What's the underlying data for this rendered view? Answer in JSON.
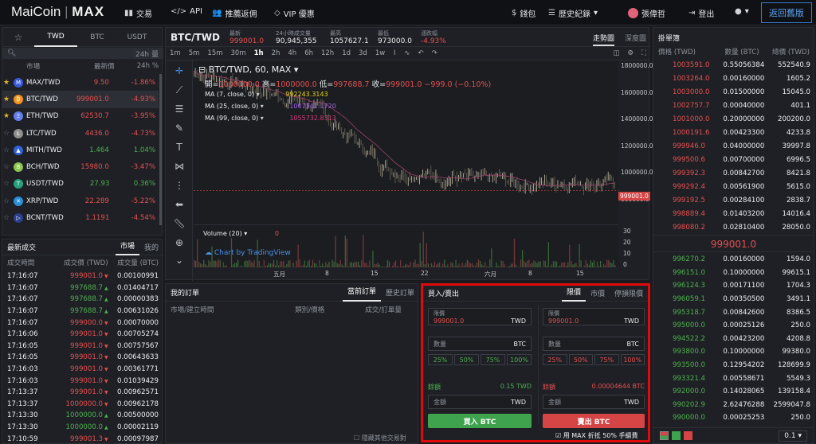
{
  "nav": {
    "logo_a": "MaiCoin",
    "logo_b": "MAX",
    "trade": "交易",
    "api": "API",
    "rebate": "推薦返佣",
    "vip": "VIP 優惠",
    "wallet": "錢包",
    "history": "歷史紀錄",
    "user": "張偉哲",
    "logout": "登出",
    "back": "返回舊版"
  },
  "market": {
    "tabs": [
      "TWD",
      "BTC",
      "USDT"
    ],
    "search_placeholder": "",
    "sort": "24h 量",
    "h_market": "市場",
    "h_price": "最新價",
    "h_change": "24h %",
    "rows": [
      {
        "fav": true,
        "icon": "M",
        "color": "#3a5bd9",
        "name": "MAX/TWD",
        "price": "9.50",
        "chg": "-1.86%",
        "up": false
      },
      {
        "fav": true,
        "icon": "₿",
        "color": "#f7931a",
        "name": "BTC/TWD",
        "price": "999001.0",
        "chg": "-4.93%",
        "up": false
      },
      {
        "fav": true,
        "icon": "Ξ",
        "color": "#627eea",
        "name": "ETH/TWD",
        "price": "62530.7",
        "chg": "-3.95%",
        "up": false
      },
      {
        "fav": false,
        "icon": "Ł",
        "color": "#8e8e8e",
        "name": "LTC/TWD",
        "price": "4436.0",
        "chg": "-4.73%",
        "up": false
      },
      {
        "fav": false,
        "icon": "▲",
        "color": "#2f64d8",
        "name": "MITH/TWD",
        "price": "1.464",
        "chg": "1.04%",
        "up": true
      },
      {
        "fav": false,
        "icon": "B",
        "color": "#8dc351",
        "name": "BCH/TWD",
        "price": "15980.0",
        "chg": "-3.47%",
        "up": false
      },
      {
        "fav": false,
        "icon": "T",
        "color": "#26a17b",
        "name": "USDT/TWD",
        "price": "27.93",
        "chg": "0.36%",
        "up": true
      },
      {
        "fav": false,
        "icon": "✕",
        "color": "#2a8fd6",
        "name": "XRP/TWD",
        "price": "22.289",
        "chg": "-5.22%",
        "up": false
      },
      {
        "fav": false,
        "icon": "▷",
        "color": "#2b3f8f",
        "name": "BCNT/TWD",
        "price": "1.1191",
        "chg": "-4.54%",
        "up": false
      }
    ]
  },
  "trades": {
    "title": "最新成交",
    "tab_market": "市場",
    "tab_mine": "我的",
    "h_time": "成交時間",
    "h_price": "成交價 (TWD)",
    "h_amt": "成交量 (BTC)",
    "rows": [
      {
        "t": "17:16:07",
        "p": "999001.0",
        "a": "0.00100991",
        "up": false
      },
      {
        "t": "17:16:07",
        "p": "997688.7",
        "a": "0.01404717",
        "up": true
      },
      {
        "t": "17:16:07",
        "p": "997688.7",
        "a": "0.00000383",
        "up": true
      },
      {
        "t": "17:16:07",
        "p": "997688.7",
        "a": "0.00631026",
        "up": true
      },
      {
        "t": "17:16:07",
        "p": "999000.0",
        "a": "0.00070000",
        "up": false
      },
      {
        "t": "17:16:06",
        "p": "999001.0",
        "a": "0.00705274",
        "up": false
      },
      {
        "t": "17:16:05",
        "p": "999001.0",
        "a": "0.00757567",
        "up": false
      },
      {
        "t": "17:16:05",
        "p": "999001.0",
        "a": "0.00643633",
        "up": false
      },
      {
        "t": "17:16:03",
        "p": "999001.0",
        "a": "0.00361771",
        "up": false
      },
      {
        "t": "17:16:03",
        "p": "999001.0",
        "a": "0.01039429",
        "up": false
      },
      {
        "t": "17:13:37",
        "p": "999001.0",
        "a": "0.00962571",
        "up": false
      },
      {
        "t": "17:13:37",
        "p": "1000000.0",
        "a": "0.00962178",
        "up": false
      },
      {
        "t": "17:13:30",
        "p": "1000000.0",
        "a": "0.00500000",
        "up": true
      },
      {
        "t": "17:13:30",
        "p": "1000000.0",
        "a": "0.00002119",
        "up": true
      },
      {
        "t": "17:10:59",
        "p": "999001.3",
        "a": "0.00097987",
        "up": false
      }
    ]
  },
  "chart": {
    "pair": "BTC/TWD",
    "l_last": "最新",
    "last": "999001.0",
    "l_vol": "24小時成交量",
    "vol": "90,945,355",
    "l_high": "最高",
    "high": "1057627.1",
    "l_low": "最低",
    "low": "973000.0",
    "l_chg": "漲跌幅",
    "chg": "-4.93%",
    "tab_trend": "走勢圖",
    "tab_depth": "深度圖",
    "tf": [
      "1m",
      "5m",
      "15m",
      "30m",
      "1h",
      "2h",
      "4h",
      "6h",
      "12h",
      "1d",
      "3d",
      "1w"
    ],
    "symbol": "BTC/TWD, 60, MAX",
    "o_l": "開=",
    "o": "1000000.0",
    "h_l": "高=",
    "h": "1000000.0",
    "lo_l": "低=",
    "lo": "997688.7",
    "c_l": "收=",
    "c": "999001.0",
    "diff": "−999.0 (−0.10%)",
    "ma7": "MA (7, close, 0)",
    "ma7v": "992243.3143",
    "ma25": "MA (25, close, 0)",
    "ma25v": "1007341.1720",
    "ma99": "MA (99, close, 0)",
    "ma99v": "1055732.8313",
    "volume": "Volume (20)",
    "volv": "0",
    "tv": "Chart by TradingView",
    "price_ticks": [
      "1800000.0",
      "1600000.0",
      "1400000.0",
      "1200000.0",
      "1000000.0",
      "800000.0"
    ],
    "cur_price": "999001.0",
    "vol_ticks": [
      "30",
      "20",
      "10",
      "0"
    ],
    "time_ticks": [
      "五月",
      "8",
      "15",
      "22",
      "六月",
      "8",
      "15"
    ]
  },
  "orders": {
    "title": "我的訂單",
    "tab_open": "當前訂單",
    "tab_hist": "歷史訂單",
    "h_market": "市場/建立時間",
    "h_type": "類別/價格",
    "h_fill": "成交/訂單量",
    "hide": "隱藏其他交易對"
  },
  "trade": {
    "title": "買入/賣出",
    "tab_limit": "限價",
    "tab_market": "市價",
    "tab_stop": "停損限價",
    "price_label": "限價",
    "price": "999001.0",
    "cur": "TWD",
    "qty": "數量",
    "coin": "BTC",
    "pcts": [
      "25%",
      "50%",
      "75%",
      "100%"
    ],
    "bal": "餘額",
    "buy_bal": "0.15 TWD",
    "sell_bal": "0.00004644 BTC",
    "total": "金額",
    "buy": "買入 BTC",
    "sell": "賣出 BTC",
    "fee": "用 MAX 折抵 50% 手續費"
  },
  "book": {
    "title": "掛單簿",
    "h_price": "價格 (TWD)",
    "h_qty": "數量 (BTC)",
    "h_total": "總價 (TWD)",
    "mid": "999001.0",
    "precision": "0.1",
    "asks": [
      [
        "1003591.0",
        "0.55056384",
        "552540.9"
      ],
      [
        "1003264.0",
        "0.00160000",
        "1605.2"
      ],
      [
        "1003000.0",
        "0.01500000",
        "15045.0"
      ],
      [
        "1002757.7",
        "0.00040000",
        "401.1"
      ],
      [
        "1001000.0",
        "0.20000000",
        "200200.0"
      ],
      [
        "1000191.6",
        "0.00423300",
        "4233.8"
      ],
      [
        "999946.0",
        "0.04000000",
        "39997.8"
      ],
      [
        "999500.6",
        "0.00700000",
        "6996.5"
      ],
      [
        "999392.3",
        "0.00842700",
        "8421.8"
      ],
      [
        "999292.4",
        "0.00561900",
        "5615.0"
      ],
      [
        "999192.5",
        "0.00284100",
        "2838.7"
      ],
      [
        "998889.4",
        "0.01403200",
        "14016.4"
      ],
      [
        "998080.2",
        "0.02810400",
        "28050.0"
      ]
    ],
    "bids": [
      [
        "996270.2",
        "0.00160000",
        "1594.0"
      ],
      [
        "996151.0",
        "0.10000000",
        "99615.1"
      ],
      [
        "996124.3",
        "0.00171100",
        "1704.3"
      ],
      [
        "996059.1",
        "0.00350500",
        "3491.1"
      ],
      [
        "995318.7",
        "0.00842600",
        "8386.5"
      ],
      [
        "995000.0",
        "0.00025126",
        "250.0"
      ],
      [
        "994522.2",
        "0.00423200",
        "4208.8"
      ],
      [
        "993800.0",
        "0.10000000",
        "99380.0"
      ],
      [
        "993500.0",
        "0.12954202",
        "128699.9"
      ],
      [
        "993321.4",
        "0.00558671",
        "5549.3"
      ],
      [
        "992000.0",
        "0.14028065",
        "139158.4"
      ],
      [
        "990202.9",
        "2.62476288",
        "2599047.8"
      ],
      [
        "990000.0",
        "0.00025253",
        "250.0"
      ]
    ]
  }
}
